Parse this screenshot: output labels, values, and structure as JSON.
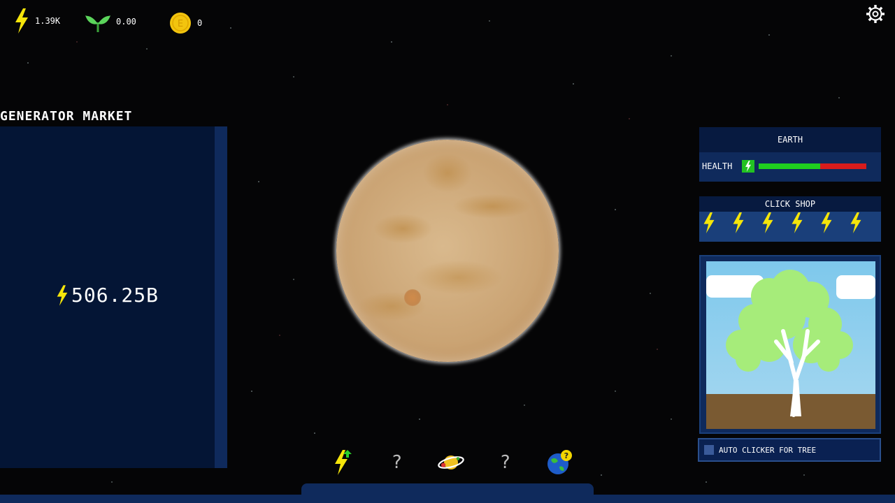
{
  "hud": {
    "energy": "1.39K",
    "plants": "0.00",
    "coins": "0",
    "coin_letter": "E"
  },
  "market": {
    "title": "GENERATOR MARKET",
    "balance": "506.25B"
  },
  "earth_panel": {
    "title": "EARTH",
    "health_label": "HEALTH",
    "health_fraction": 0.57
  },
  "click_shop": {
    "title": "CLICK SHOP",
    "items": [
      "bolt-icon",
      "bolt-icon",
      "bolt-icon",
      "bolt-icon",
      "bolt-icon",
      "bolt-icon"
    ]
  },
  "auto_clicker": {
    "label": "AUTO CLICKER FOR TREE"
  },
  "bottom_nav": {
    "locked_glyph": "?",
    "earth_badge": "?"
  },
  "colors": {
    "bolt": "#f5e50a",
    "panel": "#0f2a5c",
    "health_good": "#1fcf1f",
    "health_bad": "#d81c1c"
  }
}
